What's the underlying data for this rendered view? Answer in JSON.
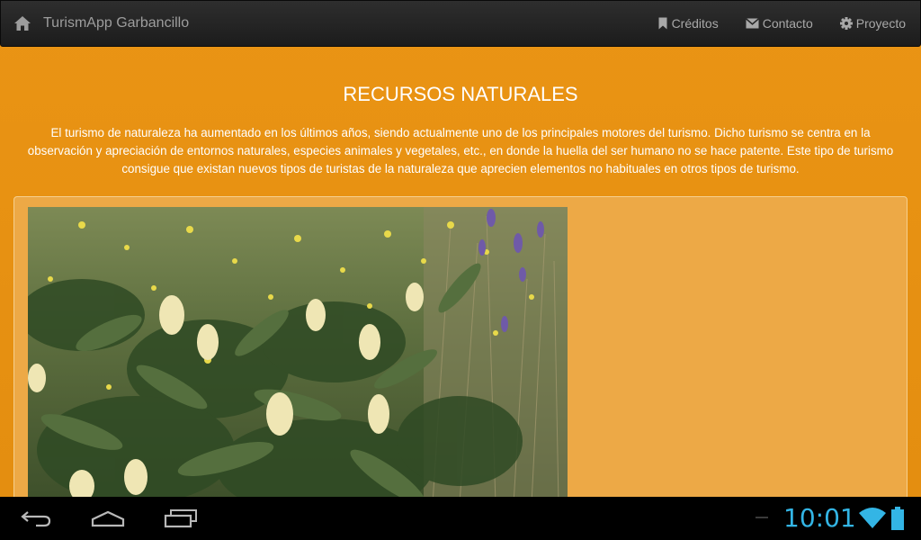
{
  "navbar": {
    "brand": "TurismApp Garbancillo",
    "links": [
      {
        "label": "Créditos",
        "icon": "bookmark-icon"
      },
      {
        "label": "Contacto",
        "icon": "envelope-icon"
      },
      {
        "label": "Proyecto",
        "icon": "gear-icon"
      }
    ]
  },
  "main": {
    "title": "RECURSOS NATURALES",
    "intro": "El turismo de naturaleza ha aumentado en los últimos años, siendo actualmente uno de los principales motores del turismo. Dicho turismo se centra en la observación y apreciación de entornos naturales, especies animales y vegetales, etc., en donde la huella del ser humano no se hace patente. Este tipo de turismo consigue que existan nuevos tipos de turistas de la naturaleza que aprecien elementos no habituales en otros tipos de turismo."
  },
  "system_bar": {
    "clock": "10:01",
    "icons": [
      "back-icon",
      "home-icon",
      "recent-apps-icon",
      "wifi-icon",
      "battery-icon"
    ]
  },
  "colors": {
    "background": "#e8900f",
    "navbar": "#222222",
    "panel": "#eda946",
    "clock": "#33b5e5"
  }
}
